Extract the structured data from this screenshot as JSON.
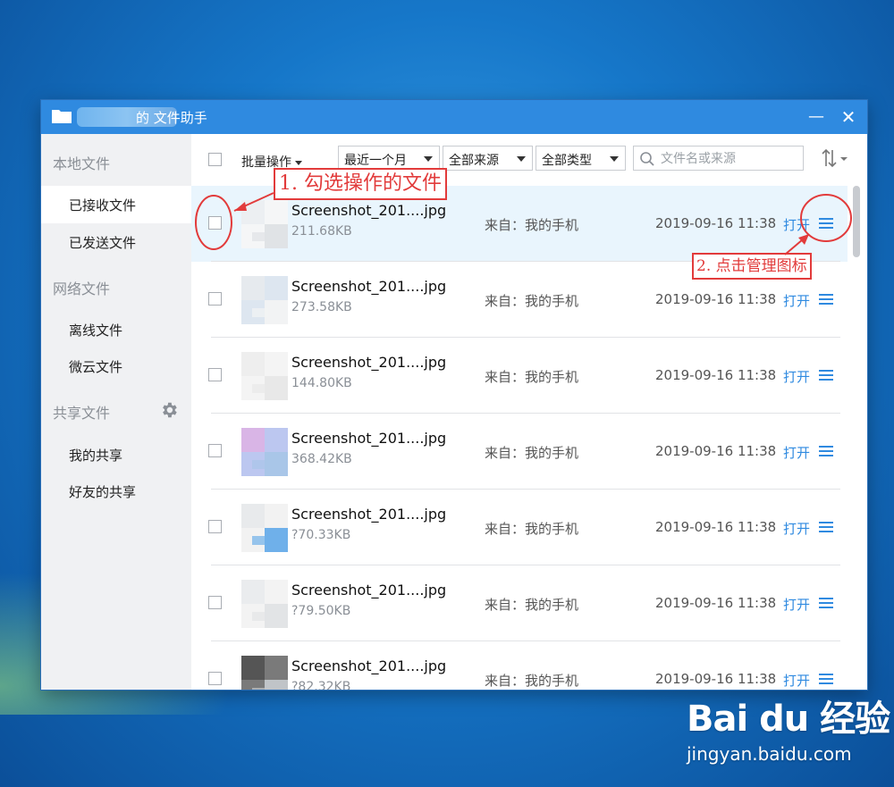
{
  "window": {
    "title": "的 文件助手",
    "minimize_glyph": "—",
    "close_glyph": "✕"
  },
  "sidebar": {
    "sections": [
      {
        "label": "本地文件",
        "items": [
          "已接收文件",
          "已发送文件"
        ]
      },
      {
        "label": "网络文件",
        "items": [
          "离线文件",
          "微云文件"
        ]
      },
      {
        "label": "共享文件",
        "items": [
          "我的共享",
          "好友的共享"
        ]
      }
    ],
    "active_item": "已接收文件"
  },
  "toolbar": {
    "batch_label": "批量操作",
    "filter_time": "最近一个月",
    "filter_source": "全部来源",
    "filter_type": "全部类型",
    "search_placeholder": "文件名或来源"
  },
  "files": [
    {
      "name": "Screenshot_201....jpg",
      "size": "211.68KB",
      "from": "来自：我的手机",
      "time": "2019-09-16 11:38",
      "open": "打开"
    },
    {
      "name": "Screenshot_201....jpg",
      "size": "273.58KB",
      "from": "来自：我的手机",
      "time": "2019-09-16 11:38",
      "open": "打开"
    },
    {
      "name": "Screenshot_201....jpg",
      "size": "144.80KB",
      "from": "来自：我的手机",
      "time": "2019-09-16 11:38",
      "open": "打开"
    },
    {
      "name": "Screenshot_201....jpg",
      "size": "368.42KB",
      "from": "来自：我的手机",
      "time": "2019-09-16 11:38",
      "open": "打开"
    },
    {
      "name": "Screenshot_201....jpg",
      "size": "?70.33KB",
      "from": "来自：我的手机",
      "time": "2019-09-16 11:38",
      "open": "打开"
    },
    {
      "name": "Screenshot_201....jpg",
      "size": "?79.50KB",
      "from": "来自：我的手机",
      "time": "2019-09-16 11:38",
      "open": "打开"
    },
    {
      "name": "Screenshot_201....jpg",
      "size": "?82.32KB",
      "from": "来自：我的手机",
      "time": "2019-09-16 11:38",
      "open": "打开"
    }
  ],
  "annotations": {
    "step1": "1. 勾选操作的文件",
    "step2": "2. 点击管理图标",
    "color": "#e23b3b"
  },
  "watermark": {
    "logo": "Bai du 经验",
    "url": "jingyan.baidu.com"
  },
  "colors": {
    "titlebar": "#2f8ae0",
    "accent": "#2f8ae0",
    "selected_row": "#e9f5fd",
    "sidebar_bg": "#f0f1f3"
  }
}
